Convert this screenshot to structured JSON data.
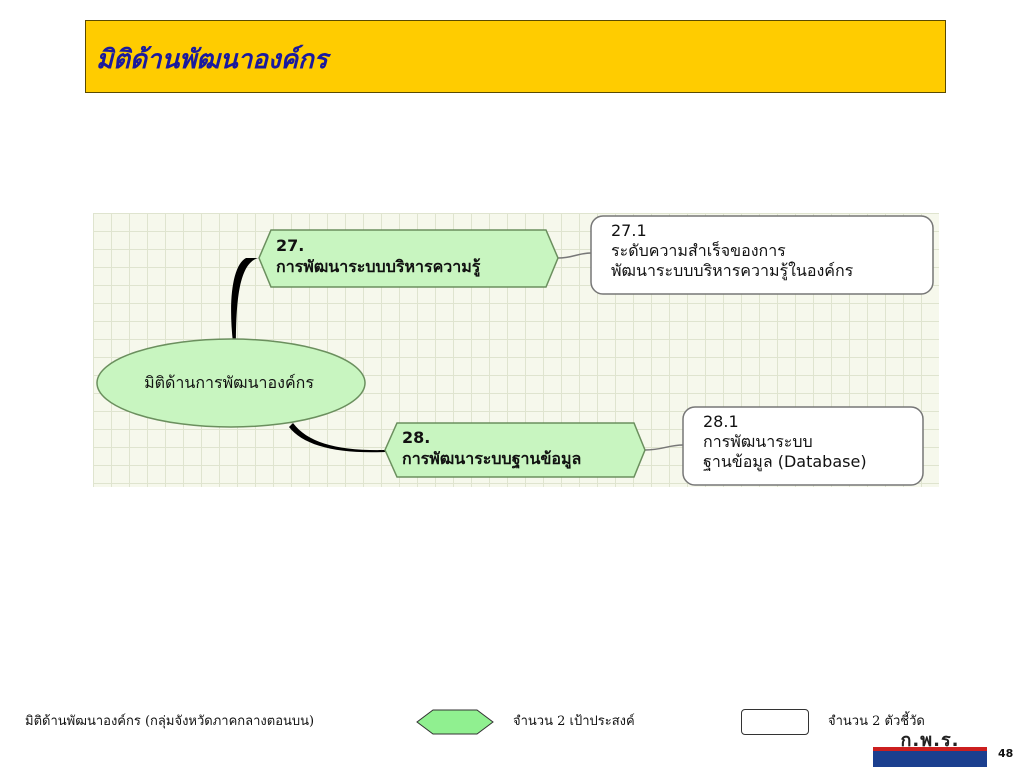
{
  "slide": {
    "title": "มิติด้านพัฒนาองค์กร",
    "page_number": "48"
  },
  "diagram": {
    "root": "มิติด้านการพัฒนาองค์กร",
    "objectives": [
      {
        "number": "27.",
        "label": "การพัฒนาระบบบริหารความรู้"
      },
      {
        "number": "28.",
        "label": "การพัฒนาระบบฐานข้อมูล"
      }
    ],
    "indicators": [
      {
        "number": "27.1",
        "line1": "ระดับความสำเร็จของการ",
        "line2": "พัฒนาระบบบริหารความรู้ในองค์กร"
      },
      {
        "number": "28.1",
        "line1": "การพัฒนาระบบ",
        "line2": "ฐานข้อมูล (Database)"
      }
    ],
    "colors": {
      "node_fill": "#c8f5c0",
      "node_border": "#6b8f5e",
      "grid": "#dfe4cf"
    }
  },
  "legend": {
    "caption": "มิติด้านพัฒนาองค์กร (กลุ่มจังหวัดภาคกลางตอนบน)",
    "objectives_count": "จำนวน 2 เป้าประสงค์",
    "indicators_count": "จำนวน 2 ตัวชี้วัด"
  },
  "logo": {
    "text": "ก.พ.ร."
  }
}
